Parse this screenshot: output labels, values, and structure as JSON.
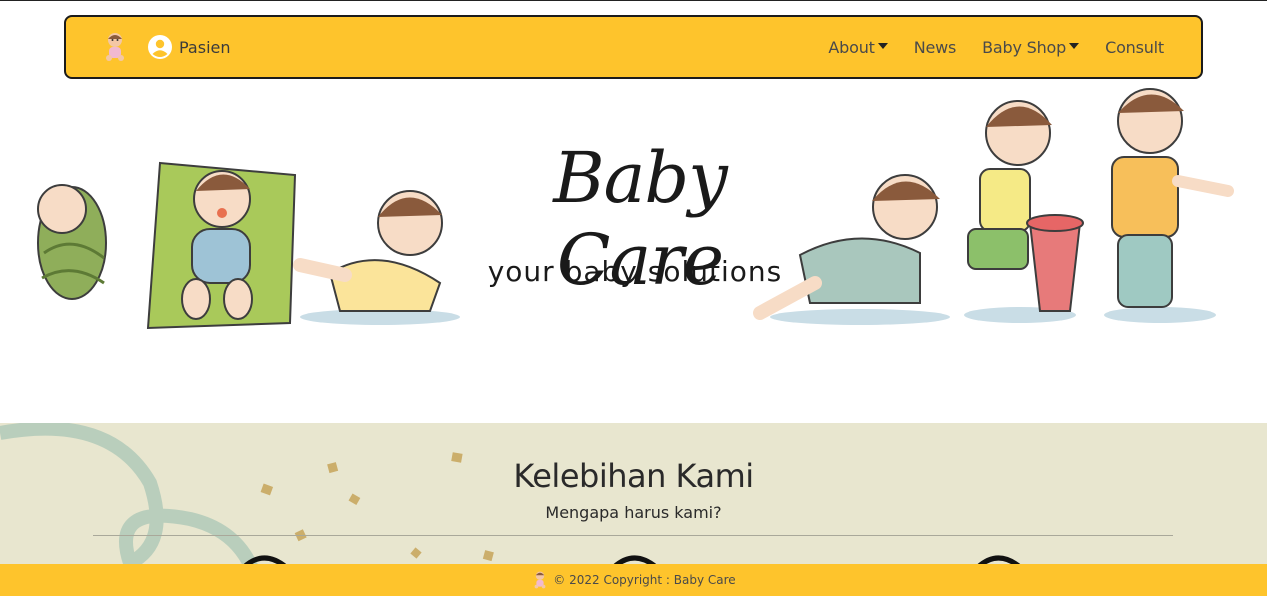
{
  "navbar": {
    "user_label": "Pasien",
    "links": [
      {
        "label": "About",
        "dropdown": true
      },
      {
        "label": "News",
        "dropdown": false
      },
      {
        "label": "Baby Shop",
        "dropdown": true
      },
      {
        "label": "Consult",
        "dropdown": false
      }
    ],
    "icons": {
      "logo": "baby-logo-icon",
      "user": "user-circle-icon",
      "caret": "caret-down-icon"
    },
    "bg_color": "#fec42c"
  },
  "hero": {
    "title": "Baby Care",
    "tagline": "your baby solutions"
  },
  "features": {
    "title": "Kelebihan Kami",
    "subtitle": "Mengapa harus kami?",
    "bg_color": "#e8e6cf"
  },
  "footer": {
    "text": "© 2022 Copyright : Baby Care"
  }
}
